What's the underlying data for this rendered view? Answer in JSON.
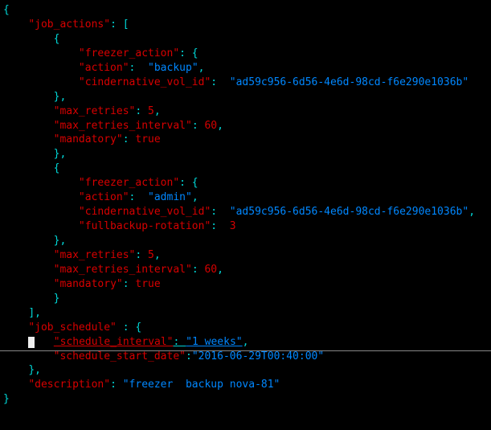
{
  "code": {
    "job_actions_key": "\"job_actions\"",
    "freezer_action_key": "\"freezer_action\"",
    "action_key": "\"action\"",
    "action_val_1": "\"backup\"",
    "action_val_2": "\"admin\"",
    "cindernative_key": "\"cindernative_vol_id\"",
    "cindernative_val": "\"ad59c956-6d56-4e6d-98cd-f6e290e1036b\"",
    "fullbackup_key": "\"fullbackup-rotation\"",
    "fullbackup_val": "3",
    "max_retries_key": "\"max_retries\"",
    "max_retries_val": "5",
    "max_retries_interval_key": "\"max_retries_interval\"",
    "max_retries_interval_val": "60",
    "mandatory_key": "\"mandatory\"",
    "mandatory_val": "true",
    "job_schedule_key": "\"job_schedule\"",
    "schedule_interval_key": "\"schedule_interval\"",
    "schedule_interval_val": "\"1 weeks\"",
    "schedule_start_key": "\"schedule_start_date\"",
    "schedule_start_val": "\"2016-06-29T00:40:00\"",
    "description_key": "\"description\"",
    "description_val": "\"freezer  backup nova-81\""
  }
}
